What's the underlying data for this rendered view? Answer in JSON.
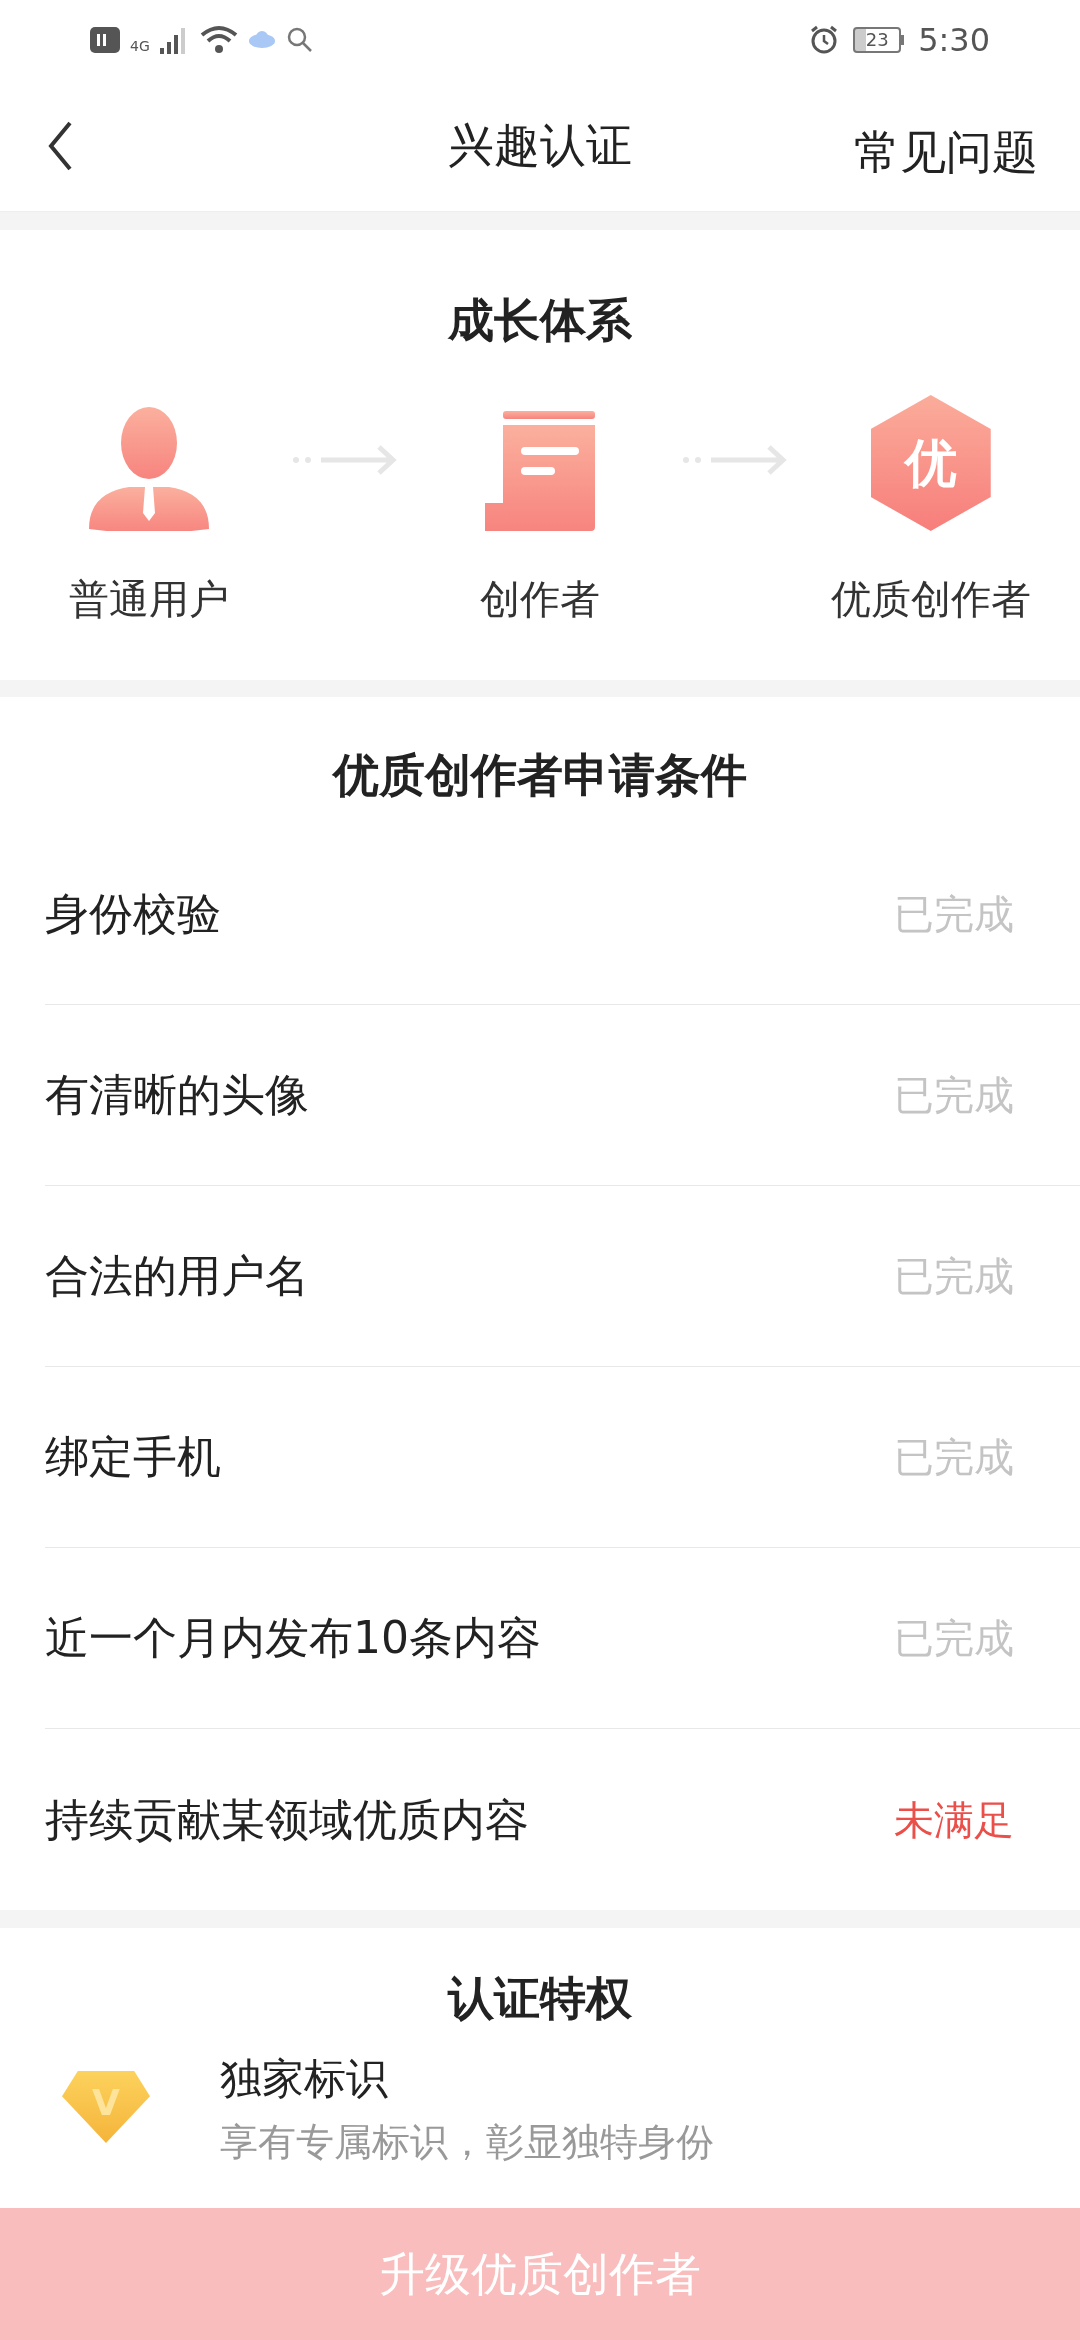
{
  "status_bar": {
    "network": "4G",
    "battery": "23",
    "time": "5:30"
  },
  "header": {
    "title": "兴趣认证",
    "action": "常见问题"
  },
  "growth": {
    "title": "成长体系",
    "stages": [
      {
        "kind": "user",
        "label": "普通用户"
      },
      {
        "kind": "creator",
        "label": "创作者"
      },
      {
        "kind": "badge",
        "badge_text": "优",
        "label": "优质创作者"
      }
    ]
  },
  "conditions": {
    "title": "优质创作者申请条件",
    "items": [
      {
        "label": "身份校验",
        "status": "已完成",
        "met": true
      },
      {
        "label": "有清晰的头像",
        "status": "已完成",
        "met": true
      },
      {
        "label": "合法的用户名",
        "status": "已完成",
        "met": true
      },
      {
        "label": "绑定手机",
        "status": "已完成",
        "met": true
      },
      {
        "label": "近一个月内发布10条内容",
        "status": "已完成",
        "met": true
      },
      {
        "label": "持续贡献某领域优质内容",
        "status": "未满足",
        "met": false
      }
    ]
  },
  "privileges": {
    "title": "认证特权",
    "items": [
      {
        "badge_text": "V",
        "title": "独家标识",
        "description": "享有专属标识，彰显独特身份"
      }
    ]
  },
  "upgrade_button": "升级优质创作者"
}
